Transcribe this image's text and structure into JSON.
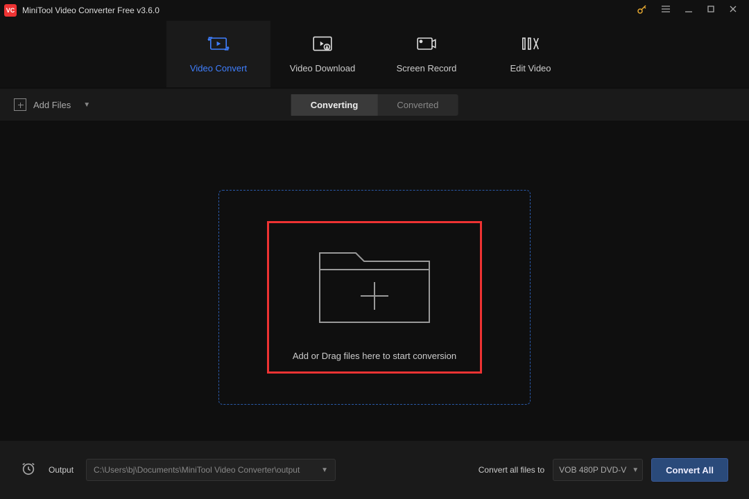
{
  "titlebar": {
    "title": "MiniTool Video Converter Free v3.6.0"
  },
  "nav": {
    "convert": "Video Convert",
    "download": "Video Download",
    "record": "Screen Record",
    "edit": "Edit Video"
  },
  "toolbar": {
    "add_files": "Add Files",
    "converting": "Converting",
    "converted": "Converted"
  },
  "main": {
    "drop_text": "Add or Drag files here to start conversion"
  },
  "bottom": {
    "output_label": "Output",
    "output_path": "C:\\Users\\bj\\Documents\\MiniTool Video Converter\\output",
    "convert_to_label": "Convert all files to",
    "format_selected": "VOB 480P DVD-V",
    "convert_all": "Convert All"
  }
}
